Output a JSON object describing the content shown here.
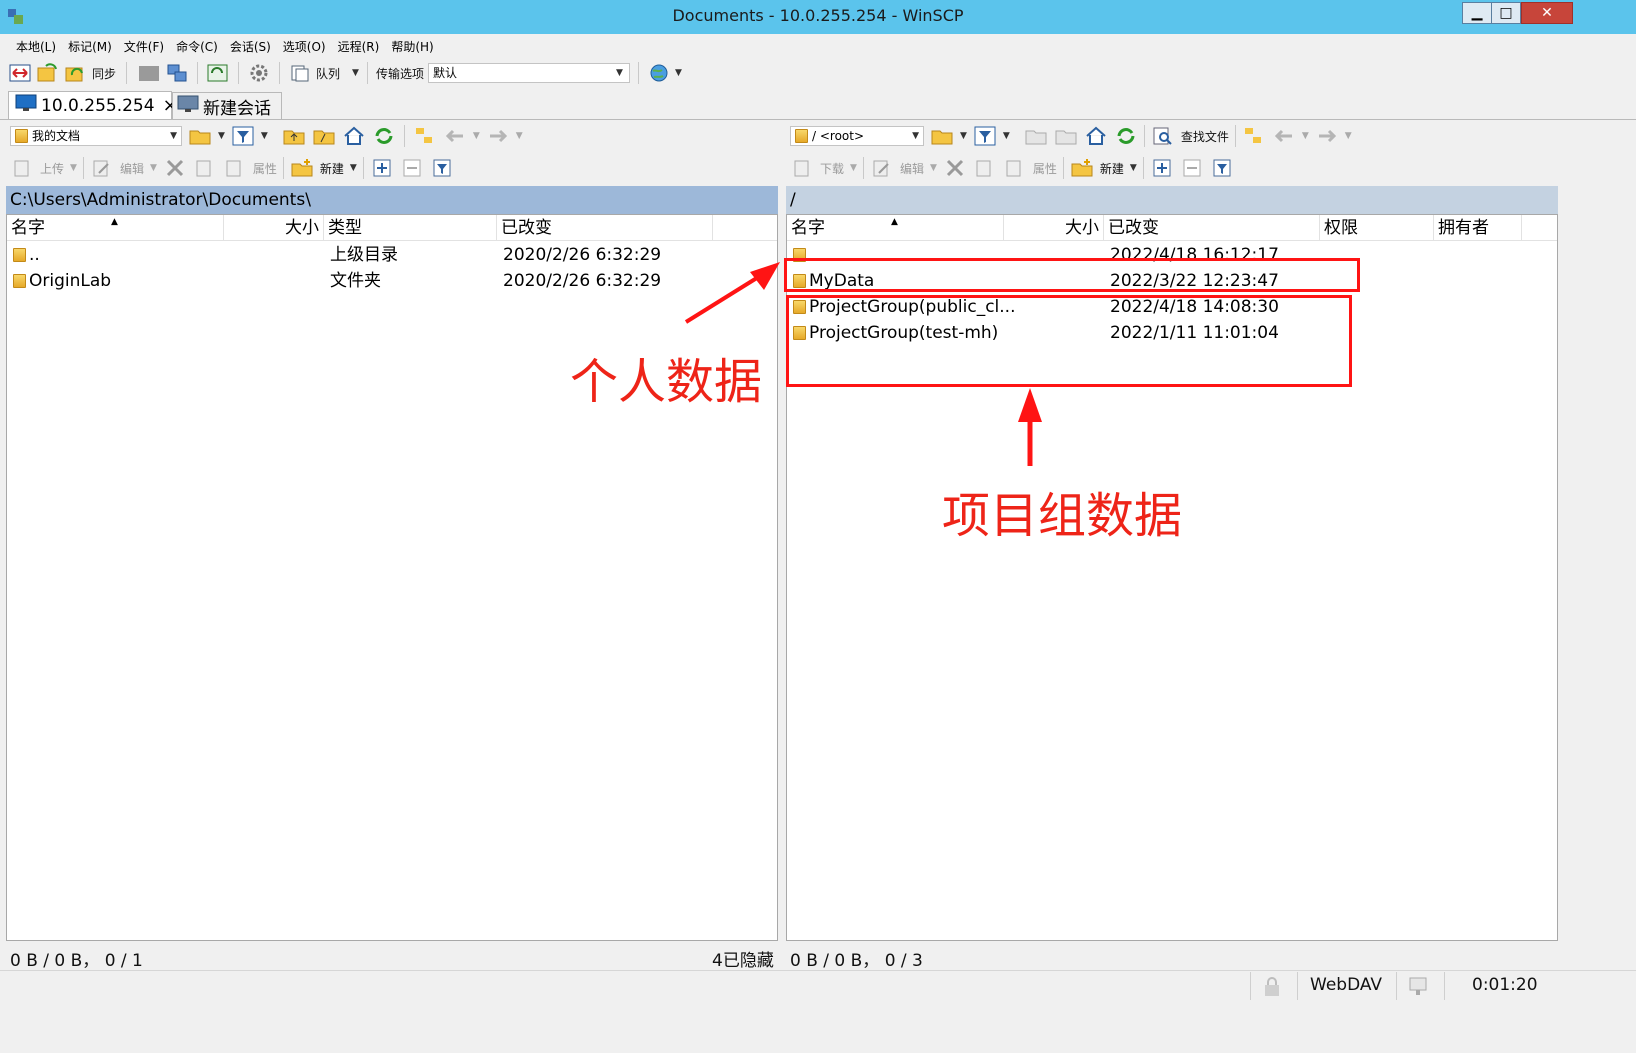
{
  "window": {
    "title": "Documents - 10.0.255.254 - WinSCP",
    "minimize": "▁",
    "maximize": "□",
    "close": "✕"
  },
  "menu": [
    "本地(L)",
    "标记(M)",
    "文件(F)",
    "命令(C)",
    "会话(S)",
    "选项(O)",
    "远程(R)",
    "帮助(H)"
  ],
  "toolbar": {
    "sync_label": "同步",
    "queue_label": "队列",
    "transfer_options_label": "传输选项",
    "transfer_preset": "默认"
  },
  "tabs": [
    {
      "label": "10.0.255.254",
      "close": "×"
    },
    {
      "label": "新建会话"
    }
  ],
  "local": {
    "location_combo": "我的文档",
    "upload_label": "上传",
    "edit_label": "编辑",
    "properties_label": "属性",
    "new_label": "新建",
    "path": "C:\\Users\\Administrator\\Documents\\",
    "columns": [
      "名字",
      "大小",
      "类型",
      "已改变"
    ],
    "rows": [
      {
        "name": "..",
        "size": "",
        "type": "上级目录",
        "changed": "2020/2/26  6:32:29"
      },
      {
        "name": "OriginLab",
        "size": "",
        "type": "文件夹",
        "changed": "2020/2/26  6:32:29"
      }
    ],
    "status_left": "0 B / 0 B， 0 / 1",
    "status_right": "4已隐藏"
  },
  "remote": {
    "location_combo": "/ <root>",
    "find_files_label": "查找文件",
    "download_label": "下载",
    "edit_label": "编辑",
    "properties_label": "属性",
    "new_label": "新建",
    "path": "/",
    "columns": [
      "名字",
      "大小",
      "已改变",
      "权限",
      "拥有者"
    ],
    "rows": [
      {
        "name": "",
        "size": "",
        "changed": "2022/4/18 16:12:17",
        "rights": "",
        "owner": ""
      },
      {
        "name": "MyData",
        "size": "",
        "changed": "2022/3/22 12:23:47",
        "rights": "",
        "owner": ""
      },
      {
        "name": "ProjectGroup(public_cl...",
        "size": "",
        "changed": "2022/4/18 14:08:30",
        "rights": "",
        "owner": ""
      },
      {
        "name": "ProjectGroup(test-mh)",
        "size": "",
        "changed": "2022/1/11 11:01:04",
        "rights": "",
        "owner": ""
      }
    ],
    "status_left": "0 B / 0 B， 0 / 3"
  },
  "bottom_status": {
    "protocol": "WebDAV",
    "elapsed": "0:01:20"
  },
  "annotations": {
    "personal": "个人数据",
    "project": "项目组数据"
  },
  "colors": {
    "titlebar": "#5bc4ec",
    "annotation_red": "#ff1414"
  }
}
